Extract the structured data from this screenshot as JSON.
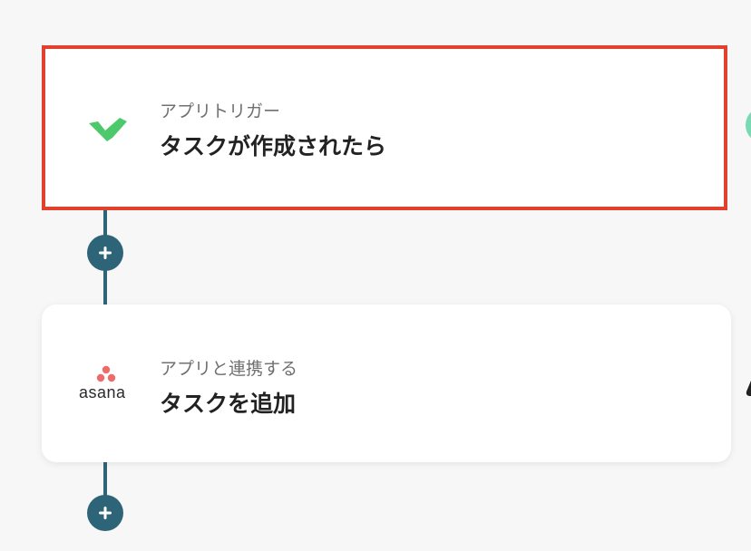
{
  "steps": [
    {
      "app_icon": "wrike-check-icon",
      "subtitle": "アプリトリガー",
      "title": "タスクが作成されたら",
      "selected": true
    },
    {
      "app_icon": "asana-logo-icon",
      "app_name": "asana",
      "subtitle": "アプリと連携する",
      "title": "タスクを追加",
      "selected": false
    }
  ],
  "colors": {
    "connector": "#2e6477",
    "selection_border": "#e2412e",
    "wrike_green": "#4cc96b",
    "asana_coral": "#f06a6a"
  }
}
